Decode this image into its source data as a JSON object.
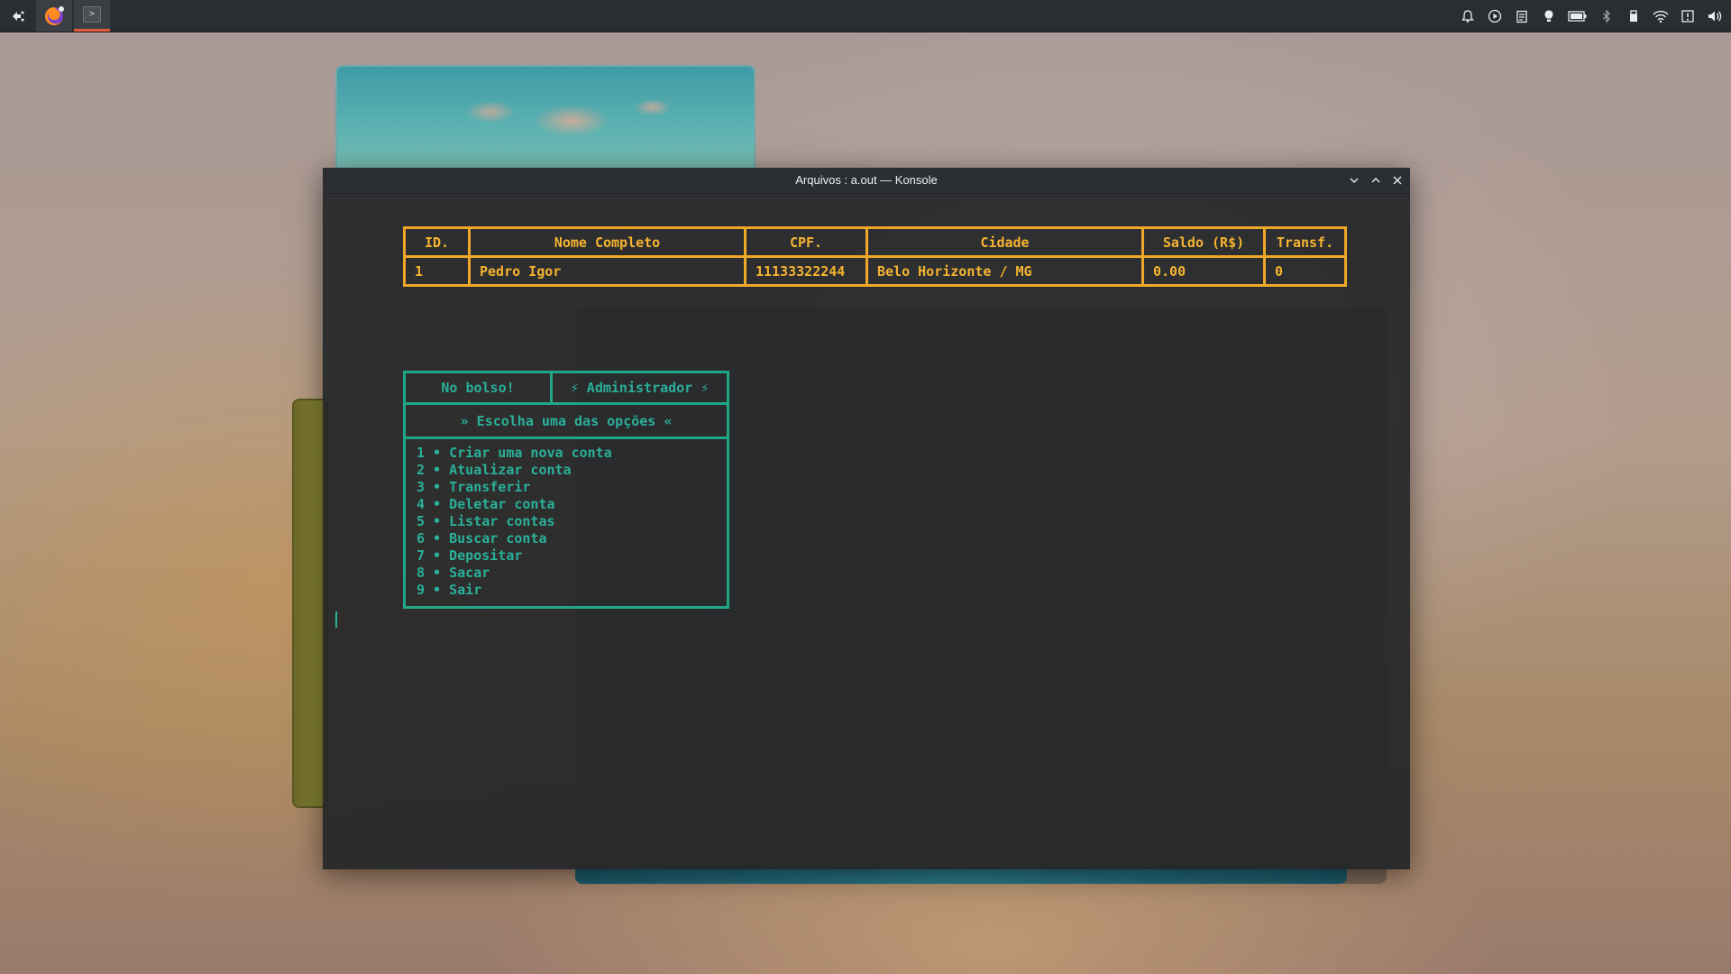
{
  "window": {
    "title": "Arquivos : a.out — Konsole"
  },
  "taskbar": {
    "konsole_glyph": ">",
    "tray_icons": [
      "notifications-icon",
      "media-player-icon",
      "clipboard-icon",
      "night-light-icon",
      "battery-icon",
      "bluetooth-icon",
      "usb-device-icon",
      "wifi-icon",
      "updates-icon",
      "volume-icon"
    ]
  },
  "account_table": {
    "headers": [
      "ID.",
      "Nome Completo",
      "CPF.",
      "Cidade",
      "Saldo (R$)",
      "Transf."
    ],
    "rows": [
      [
        "1",
        "Pedro Igor",
        "11133322244",
        "Belo Horizonte / MG",
        "0.00",
        "0"
      ]
    ]
  },
  "menu": {
    "brand": "No bolso!",
    "role": "⚡ Administrador ⚡",
    "prompt": "» Escolha uma das opções «",
    "options": [
      "1 • Criar uma nova conta",
      "2 • Atualizar conta",
      "3 • Transferir",
      "4 • Deletar conta",
      "5 • Listar contas",
      "6 • Buscar conta",
      "7 • Depositar",
      "8 • Sacar",
      "9 • Sair"
    ]
  },
  "colors": {
    "table_accent": "#f0a828",
    "menu_accent": "#1fa888",
    "terminal_bg": "#232628",
    "taskbar_bg": "#2a2e32",
    "active_task_indicator": "#e05a3c"
  }
}
